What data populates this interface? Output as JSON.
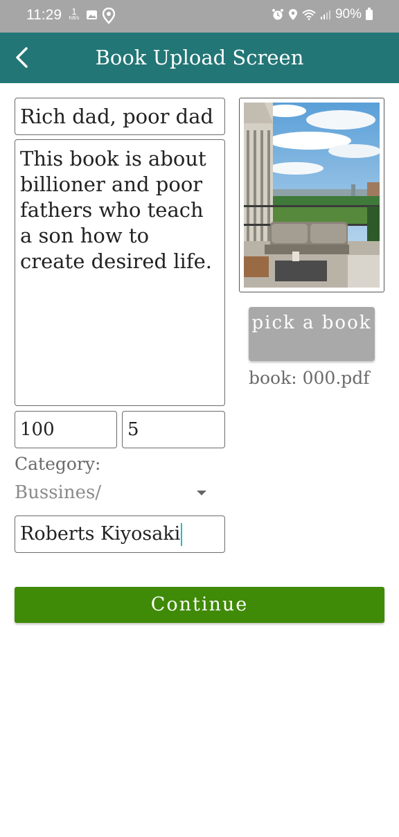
{
  "status_bar": {
    "time": "11:29",
    "speed_value": "1",
    "speed_unit": "KB/s",
    "battery": "90%"
  },
  "app_bar": {
    "title": "Book Upload Screen"
  },
  "form": {
    "title_value": "Rich dad, poor dad",
    "description_value": "This book is about billioner and poor fathers who teach a son how to create desired life.",
    "price_value": "100",
    "pages_value": "5",
    "category_label": "Category:",
    "category_selected": "Bussines/",
    "author_value": "Roberts Kiyosaki"
  },
  "cover": {
    "pick_label": "pick a book",
    "file_label": "book: 000.pdf"
  },
  "actions": {
    "continue_label": "Continue"
  },
  "colors": {
    "app_bar": "#237676",
    "continue": "#3f8a06",
    "pick_button": "#a9a9a9",
    "status_bar": "#a6a6a6"
  }
}
